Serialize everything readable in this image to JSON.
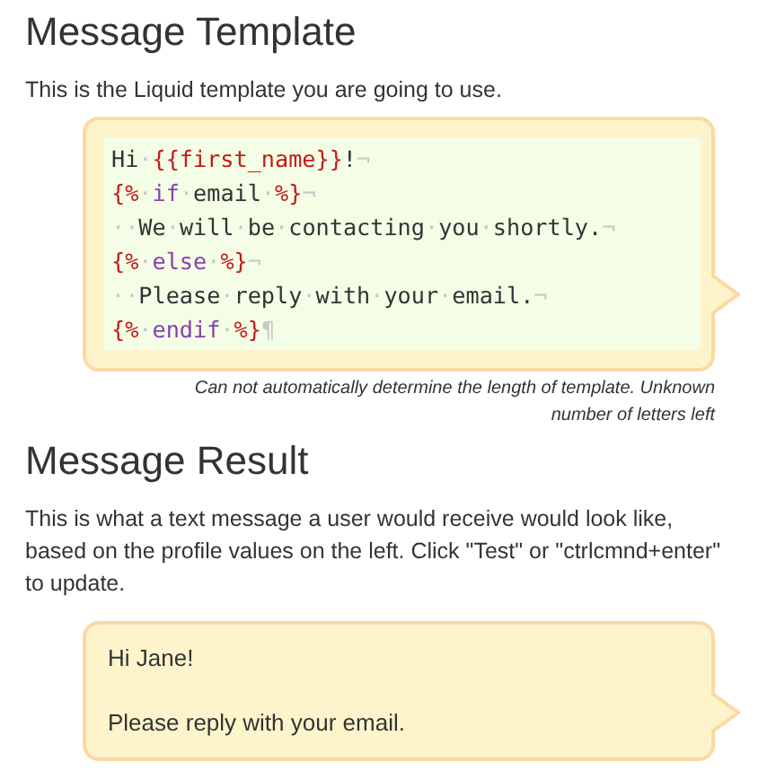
{
  "template_section": {
    "title": "Message Template",
    "description": "This is the Liquid template you are going to use.",
    "code_lines": [
      [
        {
          "kind": "text",
          "text": "Hi"
        },
        {
          "kind": "ws",
          "text": "·"
        },
        {
          "kind": "tag",
          "text": "{{first_name}}"
        },
        {
          "kind": "text",
          "text": "!"
        },
        {
          "kind": "ws",
          "text": "¬"
        }
      ],
      [
        {
          "kind": "tag",
          "text": "{%"
        },
        {
          "kind": "ws",
          "text": "·"
        },
        {
          "kind": "keyword",
          "text": "if"
        },
        {
          "kind": "ws",
          "text": "·"
        },
        {
          "kind": "text",
          "text": "email"
        },
        {
          "kind": "ws",
          "text": "·"
        },
        {
          "kind": "tag",
          "text": "%}"
        },
        {
          "kind": "ws",
          "text": "¬"
        }
      ],
      [
        {
          "kind": "ws",
          "text": "··"
        },
        {
          "kind": "text",
          "text": "We"
        },
        {
          "kind": "ws",
          "text": "·"
        },
        {
          "kind": "text",
          "text": "will"
        },
        {
          "kind": "ws",
          "text": "·"
        },
        {
          "kind": "text",
          "text": "be"
        },
        {
          "kind": "ws",
          "text": "·"
        },
        {
          "kind": "text",
          "text": "contacting"
        },
        {
          "kind": "ws",
          "text": "·"
        },
        {
          "kind": "text",
          "text": "you"
        },
        {
          "kind": "ws",
          "text": "·"
        },
        {
          "kind": "text",
          "text": "shortly."
        },
        {
          "kind": "ws",
          "text": "¬"
        }
      ],
      [
        {
          "kind": "tag",
          "text": "{%"
        },
        {
          "kind": "ws",
          "text": "·"
        },
        {
          "kind": "keyword",
          "text": "else"
        },
        {
          "kind": "ws",
          "text": "·"
        },
        {
          "kind": "tag",
          "text": "%}"
        },
        {
          "kind": "ws",
          "text": "¬"
        }
      ],
      [
        {
          "kind": "ws",
          "text": "··"
        },
        {
          "kind": "text",
          "text": "Please"
        },
        {
          "kind": "ws",
          "text": "·"
        },
        {
          "kind": "text",
          "text": "reply"
        },
        {
          "kind": "ws",
          "text": "·"
        },
        {
          "kind": "text",
          "text": "with"
        },
        {
          "kind": "ws",
          "text": "·"
        },
        {
          "kind": "text",
          "text": "your"
        },
        {
          "kind": "ws",
          "text": "·"
        },
        {
          "kind": "text",
          "text": "email."
        },
        {
          "kind": "ws",
          "text": "¬"
        }
      ],
      [
        {
          "kind": "tag",
          "text": "{%"
        },
        {
          "kind": "ws",
          "text": "·"
        },
        {
          "kind": "keyword",
          "text": "endif"
        },
        {
          "kind": "ws",
          "text": "·"
        },
        {
          "kind": "tag",
          "text": "%}"
        },
        {
          "kind": "ws",
          "text": "¶"
        }
      ]
    ],
    "length_note": "Can not automatically determine the length of template. Unknown number of letters left"
  },
  "result_section": {
    "title": "Message Result",
    "description": "This is what a text message a user would receive would look like, based on the profile values on the left. Click \"Test\" or \"ctrlcmnd+enter\" to update.",
    "message_lines": [
      "Hi Jane!",
      "Please reply with your email."
    ]
  }
}
